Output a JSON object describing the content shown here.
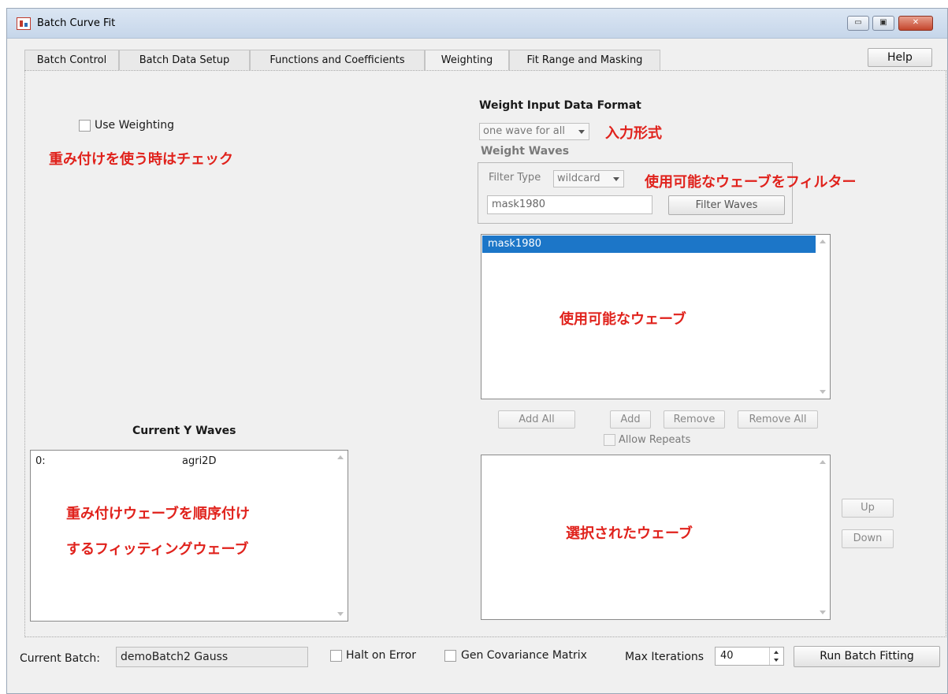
{
  "window": {
    "title": "Batch Curve Fit",
    "minimize_glyph": "▭",
    "maximize_glyph": "▣",
    "close_glyph": "✕"
  },
  "tabs": [
    {
      "label": "Batch Control"
    },
    {
      "label": "Batch Data Setup"
    },
    {
      "label": "Functions and Coefficients"
    },
    {
      "label": "Weighting",
      "active": true
    },
    {
      "label": "Fit Range and Masking"
    }
  ],
  "help_label": "Help",
  "weighting": {
    "use_weighting_label": "Use Weighting",
    "use_weighting_checked": false,
    "input_format_title": "Weight Input Data Format",
    "input_format_value": "one wave for all",
    "weight_waves_title": "Weight Waves",
    "filter_type_label": "Filter Type",
    "filter_type_value": "wildcard",
    "filter_text": "mask1980",
    "filter_button": "Filter Waves",
    "available_waves": [
      "mask1980"
    ],
    "add_all": "Add All",
    "add": "Add",
    "remove": "Remove",
    "remove_all": "Remove All",
    "allow_repeats": "Allow Repeats",
    "up": "Up",
    "down": "Down"
  },
  "current_y": {
    "title": "Current Y Waves",
    "rows": [
      {
        "index": "0:",
        "name": "agri2D"
      }
    ]
  },
  "annotations": {
    "use_weighting": "重み付けを使う時はチェック",
    "input_format": "入力形式",
    "filter": "使用可能なウェーブをフィルター",
    "available": "使用可能なウェーブ",
    "selected": "選択されたウェーブ",
    "y_waves_line1": "重み付けウェーブを順序付け",
    "y_waves_line2": "するフィッティングウェーブ"
  },
  "footer": {
    "current_batch_label": "Current Batch:",
    "current_batch_value": "demoBatch2 Gauss",
    "halt_on_error": "Halt on Error",
    "gen_covariance": "Gen Covariance Matrix",
    "max_iterations_label": "Max Iterations",
    "max_iterations_value": "40",
    "run_button": "Run Batch Fitting"
  },
  "colors": {
    "annotation": "#e0221c",
    "selection": "#1c76c8"
  }
}
